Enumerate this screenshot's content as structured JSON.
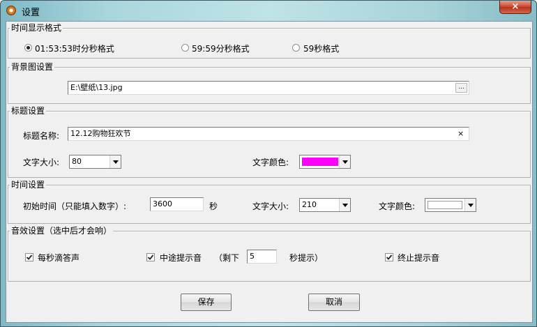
{
  "window": {
    "title": "设置",
    "close_symbol": "×"
  },
  "time_format": {
    "legend": "时间显示格式",
    "options": [
      {
        "label": "01:53:53时分秒格式",
        "selected": true
      },
      {
        "label": "59:59分秒格式",
        "selected": false
      },
      {
        "label": "59秒格式",
        "selected": false
      }
    ]
  },
  "background": {
    "legend": "背景图设置",
    "path": "E:\\壁纸\\13.jpg",
    "browse_label": "..."
  },
  "title_settings": {
    "legend": "标题设置",
    "name_label": "标题名称:",
    "name_value": "12.12购物狂欢节",
    "clear_symbol": "×",
    "font_size_label": "文字大小:",
    "font_size_value": "80",
    "color_label": "文字颜色:",
    "color_value": "#ff00ff"
  },
  "time_settings": {
    "legend": "时间设置",
    "initial_label": "初始时间（只能填入数字）:",
    "initial_value": "3600",
    "unit": "秒",
    "font_size_label": "文字大小:",
    "font_size_value": "210",
    "color_label": "文字颜色:",
    "color_value": "#ffffff"
  },
  "sound_settings": {
    "legend": "音效设置（选中后才会响）",
    "tick_label": "每秒滴答声",
    "tick_checked": true,
    "midway_label": "中途提示音",
    "midway_checked": true,
    "remaining_prefix": "（剩下",
    "remaining_value": "5",
    "remaining_suffix": "秒提示）",
    "end_label": "终止提示音",
    "end_checked": true
  },
  "buttons": {
    "save": "保存",
    "cancel": "取消"
  }
}
